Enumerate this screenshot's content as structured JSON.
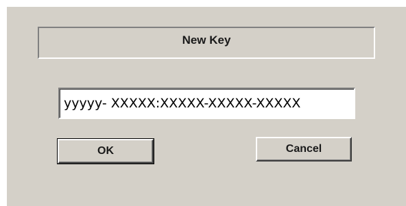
{
  "dialog": {
    "title": "New Key",
    "key_value": "yyyyy- XXXXX:XXXXX-XXXXX-XXXXX",
    "ok_label": "OK",
    "cancel_label": "Cancel"
  }
}
